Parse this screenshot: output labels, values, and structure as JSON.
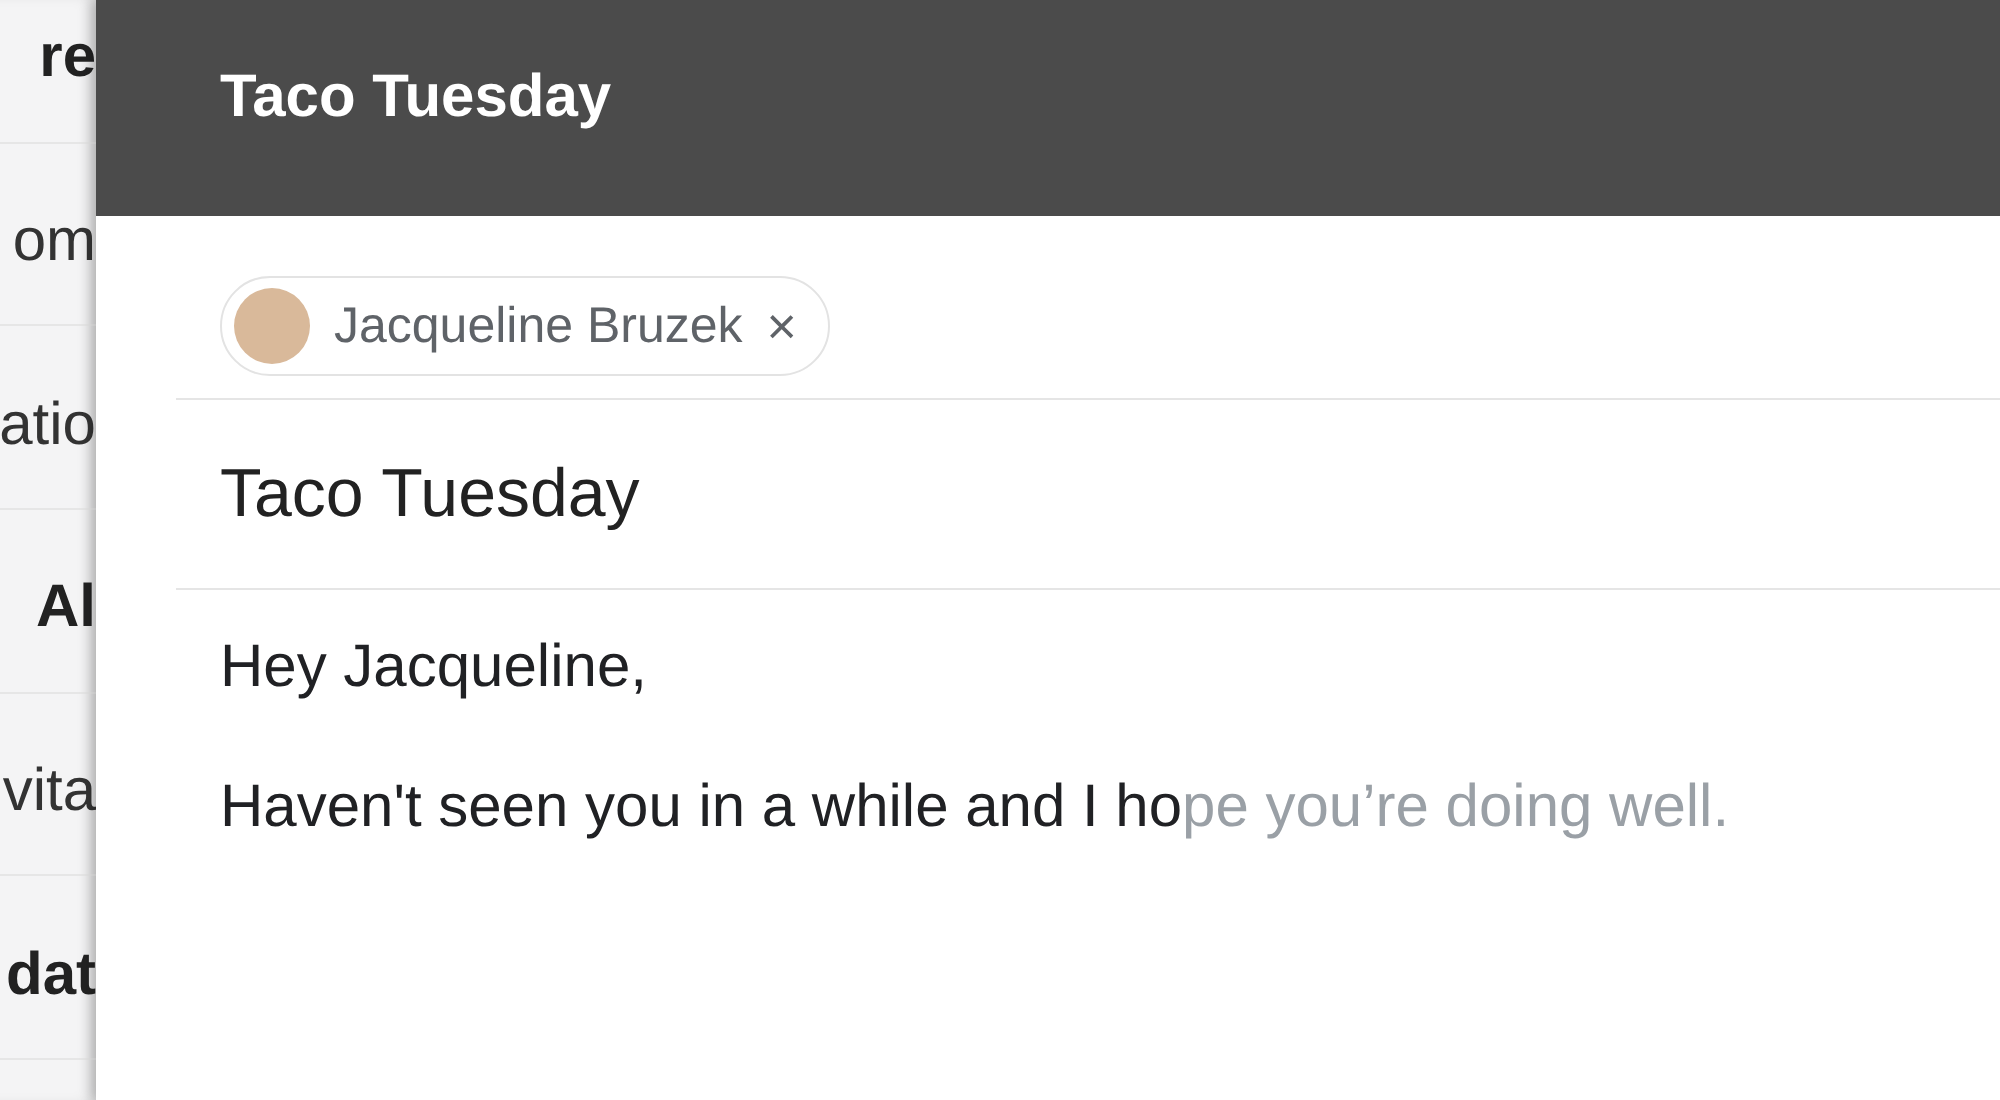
{
  "background_list": [
    {
      "text": "re",
      "unread": true
    },
    {
      "text": "om",
      "unread": false
    },
    {
      "text": "atio",
      "unread": false
    },
    {
      "text": "Al",
      "unread": true
    },
    {
      "text": "vita",
      "unread": false
    },
    {
      "text": "dat",
      "unread": true
    }
  ],
  "compose": {
    "title": "Taco Tuesday",
    "recipients": [
      {
        "name": "Jacqueline Bruzek",
        "remove": "×"
      }
    ],
    "subject": "Taco Tuesday",
    "greeting": "Hey Jacqueline,",
    "body_typed": "Haven't seen you in a while and I ho",
    "body_suggestion": "pe you’re doing well."
  }
}
